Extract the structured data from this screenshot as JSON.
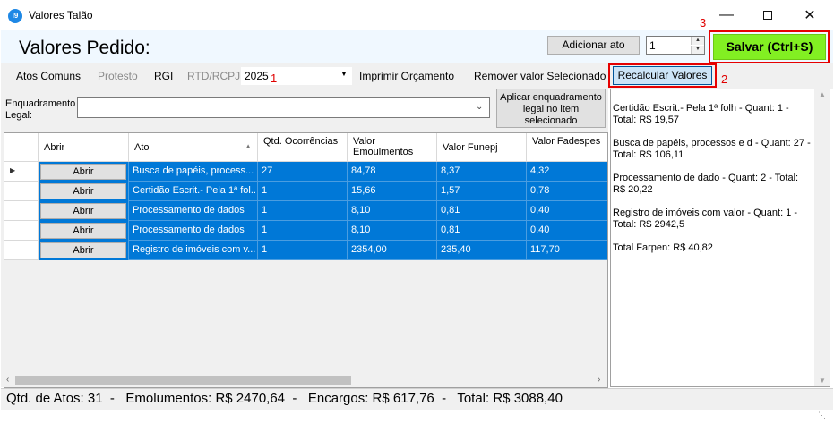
{
  "window": {
    "title": "Valores Talão",
    "icon_text": "I9"
  },
  "header": {
    "title": "Valores Pedido:",
    "add_button": "Adicionar ato",
    "quantity": "1",
    "save_button": "Salvar (Ctrl+S)",
    "annotation": "3"
  },
  "toolbar": {
    "items": [
      "Atos Comuns",
      "Protesto",
      "RGI",
      "RTD/RCPJ"
    ],
    "combo_value": "2025",
    "combo_annotation": "1",
    "print_button": "Imprimir Orçamento",
    "remove_button": "Remover valor Selecionado",
    "recalc_button": "Recalcular Valores",
    "recalc_annotation": "2"
  },
  "enquadramento": {
    "label": "Enquadramento Legal:",
    "value": "",
    "apply_button": "Aplicar enquadramento legal no item selecionado"
  },
  "grid": {
    "columns": [
      "Abrir",
      "Ato",
      "Qtd. Ocorrências",
      "Valor Emoulmentos",
      "Valor Funepj",
      "Valor Fadespes"
    ],
    "rows": [
      {
        "abrir": "Abrir",
        "ato": "Busca de papéis, process...",
        "qtd": "27",
        "emol": "84,78",
        "funepj": "8,37",
        "fadespes": "4,32"
      },
      {
        "abrir": "Abrir",
        "ato": "Certidão Escrit.- Pela 1ª fol...",
        "qtd": "1",
        "emol": "15,66",
        "funepj": "1,57",
        "fadespes": "0,78"
      },
      {
        "abrir": "Abrir",
        "ato": "Processamento de dados",
        "qtd": "1",
        "emol": "8,10",
        "funepj": "0,81",
        "fadespes": "0,40"
      },
      {
        "abrir": "Abrir",
        "ato": "Processamento de dados",
        "qtd": "1",
        "emol": "8,10",
        "funepj": "0,81",
        "fadespes": "0,40"
      },
      {
        "abrir": "Abrir",
        "ato": "Registro de imóveis com v...",
        "qtd": "1",
        "emol": "2354,00",
        "funepj": "235,40",
        "fadespes": "117,70"
      }
    ]
  },
  "summary": [
    "Certidão Escrit.- Pela 1ª folh - Quant: 1 - Total: R$ 19,57",
    "Busca de papéis, processos e d - Quant: 27 - Total: R$ 106,11",
    "Processamento de dado - Quant: 2 - Total: R$ 20,22",
    "Registro de imóveis com valor - Quant: 1 - Total: R$ 2942,5",
    "Total Farpen: R$ 40,82"
  ],
  "status": {
    "text": "Qtd. de Atos: 31  -   Emolumentos: R$ 2470,64  -   Encargos: R$ 617,76  -   Total: R$ 3088,40"
  },
  "colors": {
    "selection": "#0078d7",
    "save": "#82ef22",
    "highlight_box": "#e60000"
  }
}
